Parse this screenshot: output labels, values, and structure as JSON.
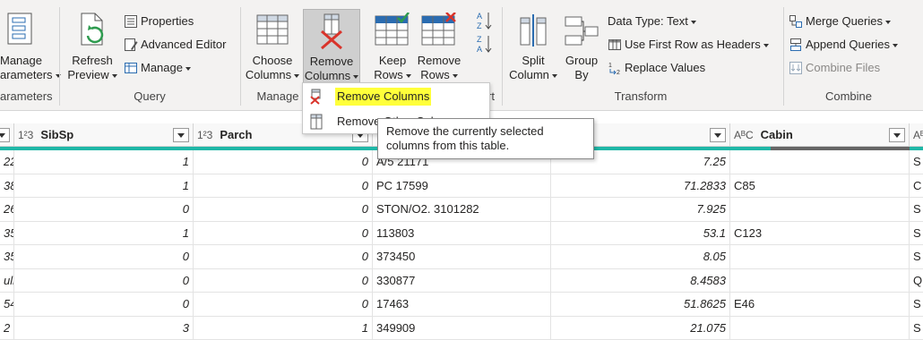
{
  "ribbon": {
    "manage_parameters": {
      "line1": "Manage",
      "line2": "arameters"
    },
    "refresh_preview": {
      "line1": "Refresh",
      "line2": "Preview"
    },
    "properties": "Properties",
    "advanced_editor": "Advanced Editor",
    "manage": "Manage",
    "choose_columns": {
      "line1": "Choose",
      "line2": "Columns"
    },
    "remove_columns": {
      "line1": "Remove",
      "line2": "Columns"
    },
    "keep_rows": {
      "line1": "Keep",
      "line2": "Rows"
    },
    "remove_rows": {
      "line1": "Remove",
      "line2": "Rows"
    },
    "split_column": {
      "line1": "Split",
      "line2": "Column"
    },
    "group_by": {
      "line1": "Group",
      "line2": "By"
    },
    "data_type": "Data Type: Text",
    "use_first_row": "Use First Row as Headers",
    "replace_values": "Replace Values",
    "merge_queries": "Merge Queries",
    "append_queries": "Append Queries",
    "combine_files": "Combine Files",
    "groups": {
      "parameters": "arameters",
      "query": "Query",
      "manage": "Manage",
      "sort_partial": "rt",
      "transform": "Transform",
      "combine": "Combine"
    }
  },
  "menu": {
    "remove_columns": "Remove Columns",
    "remove_other_columns": "Remove Other Columns"
  },
  "tooltip": {
    "line1": "Remove the currently selected",
    "line2": "columns from this table."
  },
  "grid": {
    "headers": [
      {
        "type": "",
        "name": ""
      },
      {
        "type": "1²3",
        "name": "SibSp"
      },
      {
        "type": "1²3",
        "name": "Parch"
      },
      {
        "type": "",
        "name": ""
      },
      {
        "type": "",
        "name": "re"
      },
      {
        "type": "AᴮC",
        "name": "Cabin"
      },
      {
        "type": "AᴮC",
        "name": ""
      }
    ],
    "rows": [
      [
        "22",
        "1",
        "0",
        "A/5 21171",
        "7.25",
        "",
        "S"
      ],
      [
        "38",
        "1",
        "0",
        "PC 17599",
        "71.2833",
        "C85",
        "C"
      ],
      [
        "26",
        "0",
        "0",
        "STON/O2. 3101282",
        "7.925",
        "",
        "S"
      ],
      [
        "35",
        "1",
        "0",
        "113803",
        "53.1",
        "C123",
        "S"
      ],
      [
        "35",
        "0",
        "0",
        "373450",
        "8.05",
        "",
        "S"
      ],
      [
        "ull",
        "0",
        "0",
        "330877",
        "8.4583",
        "",
        "Q"
      ],
      [
        "54",
        "0",
        "0",
        "17463",
        "51.8625",
        "E46",
        "S"
      ],
      [
        "2",
        "3",
        "1",
        "349909",
        "21.075",
        "",
        "S"
      ]
    ]
  }
}
